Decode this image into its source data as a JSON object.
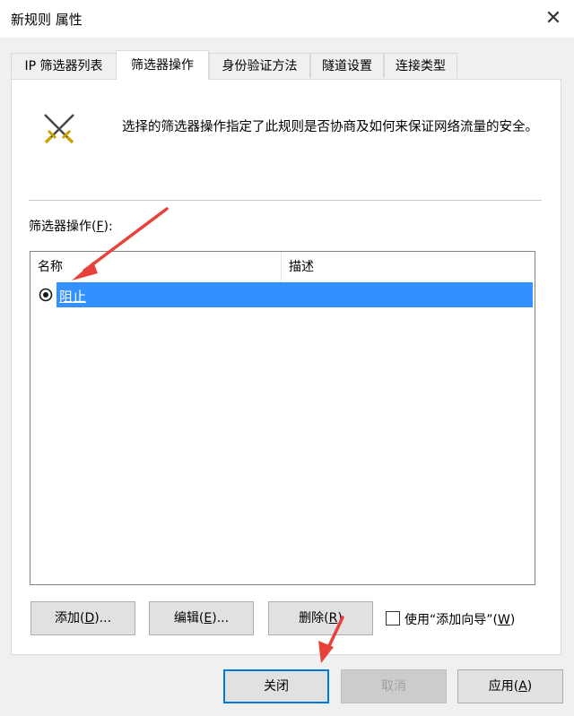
{
  "window": {
    "title": "新规则 属性"
  },
  "tabs": [
    {
      "label": "IP 筛选器列表"
    },
    {
      "label": "筛选器操作"
    },
    {
      "label": "身份验证方法"
    },
    {
      "label": "隧道设置"
    },
    {
      "label": "连接类型"
    }
  ],
  "panel": {
    "description": "选择的筛选器操作指定了此规则是否协商及如何来保证网络流量的安全。",
    "list_label": "筛选器操作(",
    "list_label_key": "F",
    "list_label_end": "):",
    "columns": [
      "名称",
      "描述"
    ],
    "rows": [
      {
        "name": "阻止",
        "description": "",
        "selected": true
      }
    ]
  },
  "buttons": {
    "add": {
      "text": "添加(",
      "key": "D",
      "end": ")..."
    },
    "edit": {
      "text": "编辑(",
      "key": "E",
      "end": ")..."
    },
    "delete": {
      "text": "删除(",
      "key": "R",
      "end": ")"
    },
    "wizard": {
      "text": "使用“添加向导”(",
      "key": "W",
      "end": ")"
    },
    "close": "关闭",
    "cancel": "取消",
    "apply": {
      "text": "应用(",
      "key": "A",
      "end": ")"
    }
  },
  "colors": {
    "selection": "#3390ff",
    "annotation_arrow": "#e8413a",
    "default_button_border": "#0078d7"
  },
  "icons": {
    "rule_icon": "crossed-swords-icon",
    "radio": "radio-selected-icon",
    "close": "close-icon"
  }
}
